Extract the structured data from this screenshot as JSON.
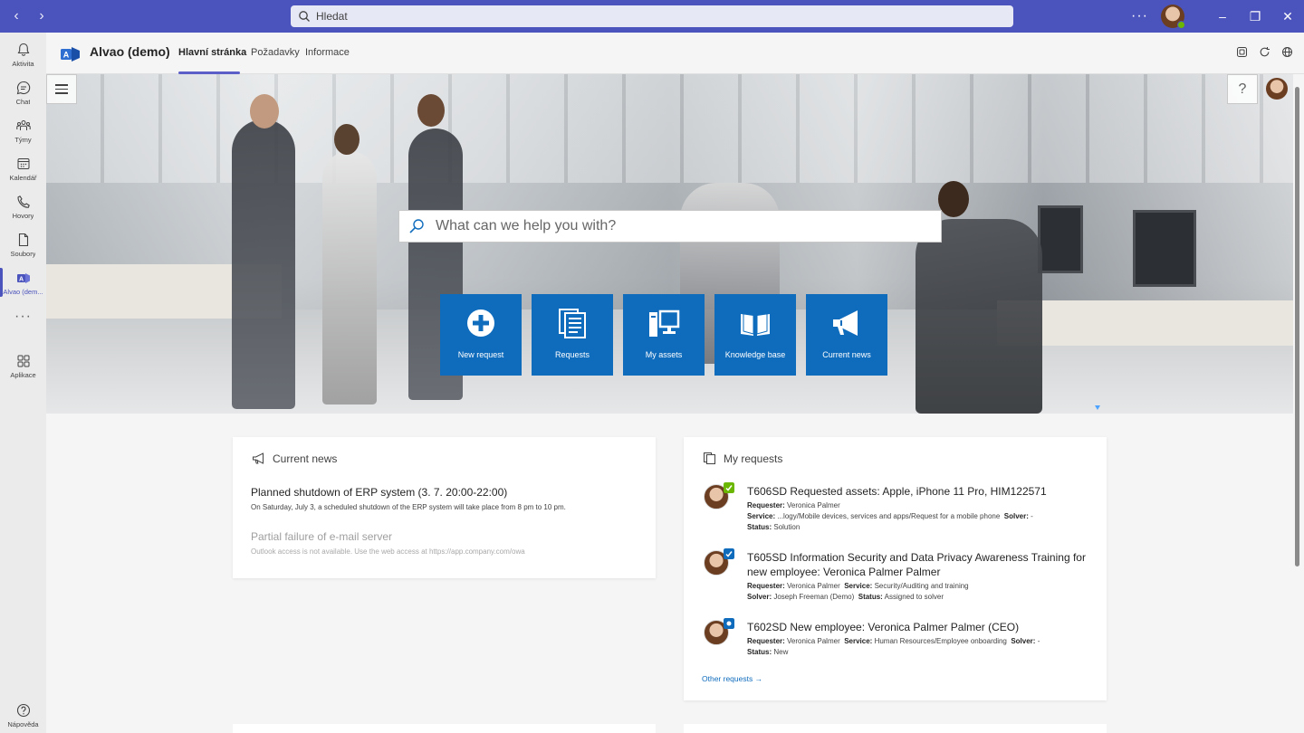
{
  "titlebar": {
    "search_placeholder": "Hledat",
    "more": "···",
    "window_controls": [
      "minimize-icon",
      "restore-icon",
      "close-icon"
    ]
  },
  "rail": {
    "items": [
      {
        "label": "Aktivita",
        "icon": "bell-icon"
      },
      {
        "label": "Chat",
        "icon": "chat-icon"
      },
      {
        "label": "Týmy",
        "icon": "teams-icon"
      },
      {
        "label": "Kalendář",
        "icon": "calendar-icon"
      },
      {
        "label": "Hovory",
        "icon": "phone-icon"
      },
      {
        "label": "Soubory",
        "icon": "file-icon"
      },
      {
        "label": "Alvao (dem...",
        "icon": "alvao-icon",
        "active": true
      }
    ],
    "more": "···",
    "apps_label": "Aplikace",
    "help_label": "Nápověda"
  },
  "app": {
    "name": "Alvao (demo)",
    "tabs": [
      {
        "label": "Hlavní stránka",
        "active": true
      },
      {
        "label": "Požadavky"
      },
      {
        "label": "Informace"
      }
    ]
  },
  "hero": {
    "search_placeholder": "What can we help you with?",
    "help": "?",
    "tiles": [
      {
        "label": "New request",
        "icon": "plus-circle-icon"
      },
      {
        "label": "Requests",
        "icon": "documents-icon"
      },
      {
        "label": "My assets",
        "icon": "computer-icon"
      },
      {
        "label": "Knowledge base",
        "icon": "book-icon"
      },
      {
        "label": "Current news",
        "icon": "megaphone-icon"
      }
    ]
  },
  "news": {
    "title": "Current news",
    "items": [
      {
        "title": "Planned shutdown of ERP system (3. 7. 20:00-22:00)",
        "body": "On Saturday, July 3, a scheduled shutdown of the ERP system will take place from 8 pm to 10 pm."
      },
      {
        "title": "Partial failure of e-mail server",
        "body": "Outlook access is not available. Use the web access at https://app.company.com/owa"
      }
    ]
  },
  "requests": {
    "title": "My requests",
    "items": [
      {
        "title": "T606SD Requested assets: Apple, iPhone 11 Pro, HIM122571",
        "requester_label": "Requester:",
        "requester": "Veronica Palmer",
        "service_label": "Service:",
        "service": "...logy/Mobile devices, services and apps/Request for a mobile phone",
        "solver_label": "Solver:",
        "solver": "-",
        "status_label": "Status:",
        "status": "Solution",
        "badge_color": "#6bb700"
      },
      {
        "title": "T605SD Information Security and Data Privacy Awareness Training for new employee: Veronica Palmer Palmer",
        "requester_label": "Requester:",
        "requester": "Veronica Palmer",
        "service_label": "Service:",
        "service": "Security/Auditing and training",
        "solver_label": "Solver:",
        "solver": "Joseph Freeman (Demo)",
        "status_label": "Status:",
        "status": "Assigned to solver",
        "badge_color": "#0f6cbd"
      },
      {
        "title": "T602SD New employee: Veronica Palmer Palmer (CEO)",
        "requester_label": "Requester:",
        "requester": "Veronica Palmer",
        "service_label": "Service:",
        "service": "Human Resources/Employee onboarding",
        "solver_label": "Solver:",
        "solver": "-",
        "status_label": "Status:",
        "status": "New",
        "badge_color": "#0f6cbd"
      }
    ],
    "other_link": "Other requests →"
  },
  "colors": {
    "accent": "#4b53bc",
    "tile": "#0f6cbd",
    "link": "#0f6cbd"
  }
}
